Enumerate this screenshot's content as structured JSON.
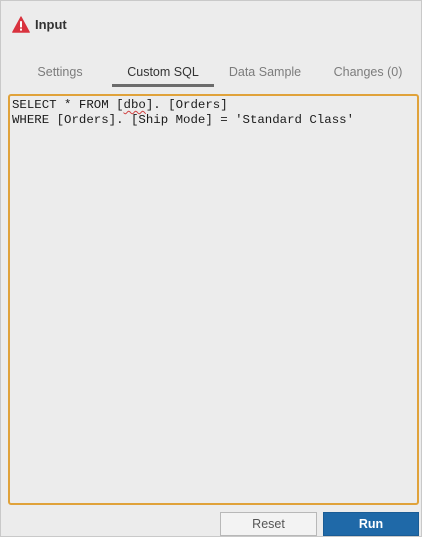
{
  "header": {
    "title": "Input",
    "icon": "warning-icon",
    "icon_color": "#d9333f"
  },
  "tabs": [
    {
      "label": "Settings",
      "active": false
    },
    {
      "label": "Custom SQL",
      "active": true
    },
    {
      "label": "Data Sample",
      "active": false
    },
    {
      "label": "Changes (0)",
      "active": false
    }
  ],
  "editor": {
    "lines": [
      {
        "pre": "SELECT * FROM [",
        "flagged": "dbo",
        "post": "]. [Orders]"
      },
      {
        "text": "WHERE [Orders]. [Ship Mode] = 'Standard Class'"
      }
    ],
    "border_color": "#e0a23a"
  },
  "buttons": {
    "reset_label": "Reset",
    "run_label": "Run",
    "run_color": "#1f69a8"
  }
}
